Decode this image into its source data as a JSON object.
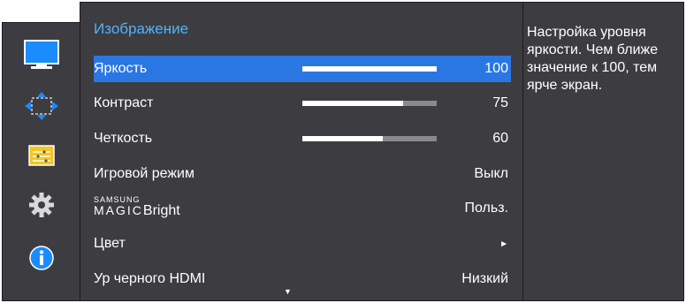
{
  "colors": {
    "panel_bg": "#3d3c41",
    "selected_bg": "#2a77e3",
    "title": "#4fb4ff",
    "bar_track": "#8a898e",
    "bar_fill": "#ffffff"
  },
  "sidebar": {
    "icons": [
      "picture-icon",
      "screen-adjust-icon",
      "settings-list-icon",
      "gear-icon",
      "info-icon"
    ]
  },
  "menu": {
    "title": "Изображение",
    "items": [
      {
        "label": "Яркость",
        "value": "100",
        "level": 100,
        "selected": true
      },
      {
        "label": "Контраст",
        "value": "75",
        "level": 75
      },
      {
        "label": "Четкость",
        "value": "60",
        "level": 60
      },
      {
        "label": "Игровой режим",
        "value": "Выкл"
      },
      {
        "label_samsung": "SAMSUNG",
        "label_magic": "MAGIC",
        "label_bright": "Bright",
        "value": "Польз."
      },
      {
        "label": "Цвет",
        "value": "►"
      },
      {
        "label": "Ур черного HDMI",
        "value": "Низкий"
      }
    ],
    "scroll_indicator": "▼"
  },
  "help": {
    "text": "Настройка уровня яркости. Чем ближе значение к 100, тем ярче экран."
  }
}
